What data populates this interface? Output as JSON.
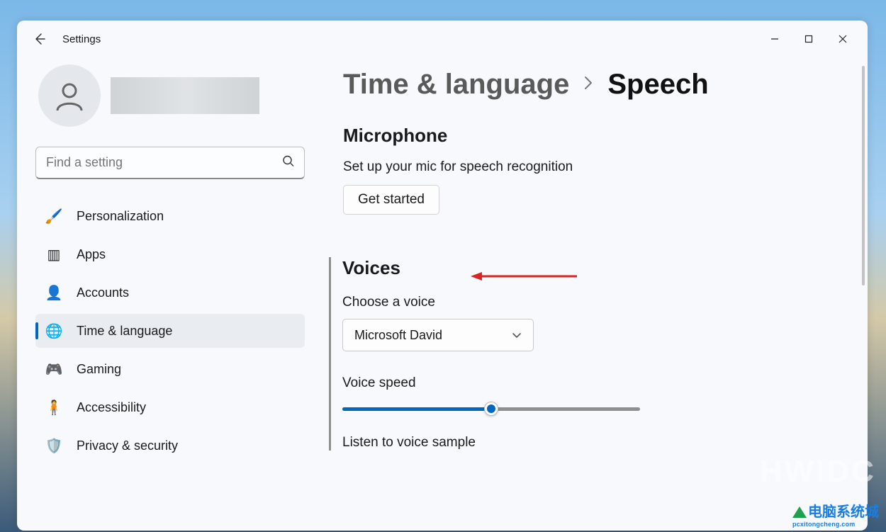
{
  "app": {
    "title": "Settings"
  },
  "search": {
    "placeholder": "Find a setting"
  },
  "sidebar": {
    "items": [
      {
        "label": "Personalization",
        "icon": "🖌️"
      },
      {
        "label": "Apps",
        "icon": "▥"
      },
      {
        "label": "Accounts",
        "icon": "👤"
      },
      {
        "label": "Time & language",
        "icon": "🌐"
      },
      {
        "label": "Gaming",
        "icon": "🎮"
      },
      {
        "label": "Accessibility",
        "icon": "🧍"
      },
      {
        "label": "Privacy & security",
        "icon": "🛡️"
      }
    ],
    "selected_index": 3
  },
  "breadcrumb": {
    "parent": "Time & language",
    "current": "Speech"
  },
  "microphone": {
    "title": "Microphone",
    "description": "Set up your mic for speech recognition",
    "button": "Get started"
  },
  "voices": {
    "title": "Voices",
    "choose_label": "Choose a voice",
    "selected_voice": "Microsoft David",
    "speed_label": "Voice speed",
    "speed_value_percent": 50,
    "sample_label": "Listen to voice sample"
  },
  "watermarks": {
    "hwidc": "HWIDC",
    "cn": "电脑系统城",
    "en": "pcxitongcheng.com"
  }
}
